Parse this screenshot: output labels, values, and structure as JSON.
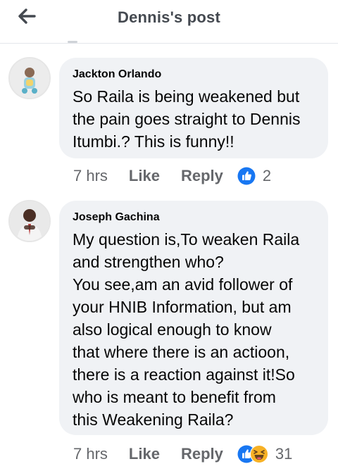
{
  "header": {
    "title": "Dennis's post"
  },
  "comments": [
    {
      "author": "Jackton Orlando",
      "text": "So Raila is being weakened but\nthe pain goes straight to Dennis\nItumbi.? This is funny!!",
      "time": "7 hrs",
      "like_label": "Like",
      "reply_label": "Reply",
      "reaction_count": "2",
      "reactions": [
        "like-icon"
      ]
    },
    {
      "author": "Joseph Gachina",
      "text": "My question is,To weaken Raila\nand strengthen who?\nYou see,am an avid follower of\nyour HNIB Information, but am\nalso logical enough to know\nthat where there is an actioon,\nthere is a reaction against it!So\nwho is meant to benefit from\nthis Weakening Raila?",
      "time": "7 hrs",
      "like_label": "Like",
      "reply_label": "Reply",
      "reaction_count": "31",
      "reactions": [
        "like-icon",
        "haha-icon"
      ]
    }
  ],
  "colors": {
    "like_blue": "#1877f2",
    "muted": "#65676b",
    "bubble": "#f0f2f5"
  }
}
